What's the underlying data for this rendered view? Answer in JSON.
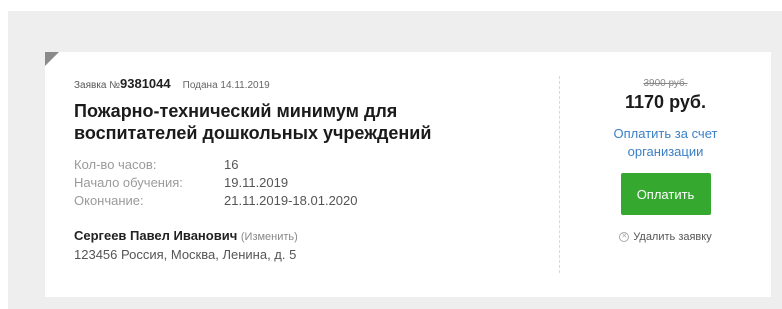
{
  "order": {
    "prefix": "Заявка №",
    "number": "9381044",
    "submitted": "Подана 14.11.2019",
    "title_line1": "Пожарно-технический минимум для",
    "title_line2": "воспитателей дошкольных учреждений",
    "hours_label": "Кол-во часов:",
    "hours_value": "16",
    "start_label": "Начало обучения:",
    "start_value": "19.11.2019",
    "end_label": "Окончание:",
    "end_value": "21.11.2019-18.01.2020",
    "person_name": "Сергеев Павел Иванович",
    "change_label": "(Изменить)",
    "address": "123456 Россия, Москва, Ленина, д. 5"
  },
  "pricing": {
    "old_price": "3900 руб.",
    "new_price": "1170 руб.",
    "org_pay_label": "Оплатить за счет организации",
    "pay_button": "Оплатить",
    "remove_label": "Удалить заявку"
  },
  "colors": {
    "accent_green": "#35a82f",
    "link_blue": "#3a7fc5",
    "background": "#eeeeee"
  },
  "icons": {
    "remove": "remove-circle-icon",
    "corner": "corner-triangle-icon"
  }
}
